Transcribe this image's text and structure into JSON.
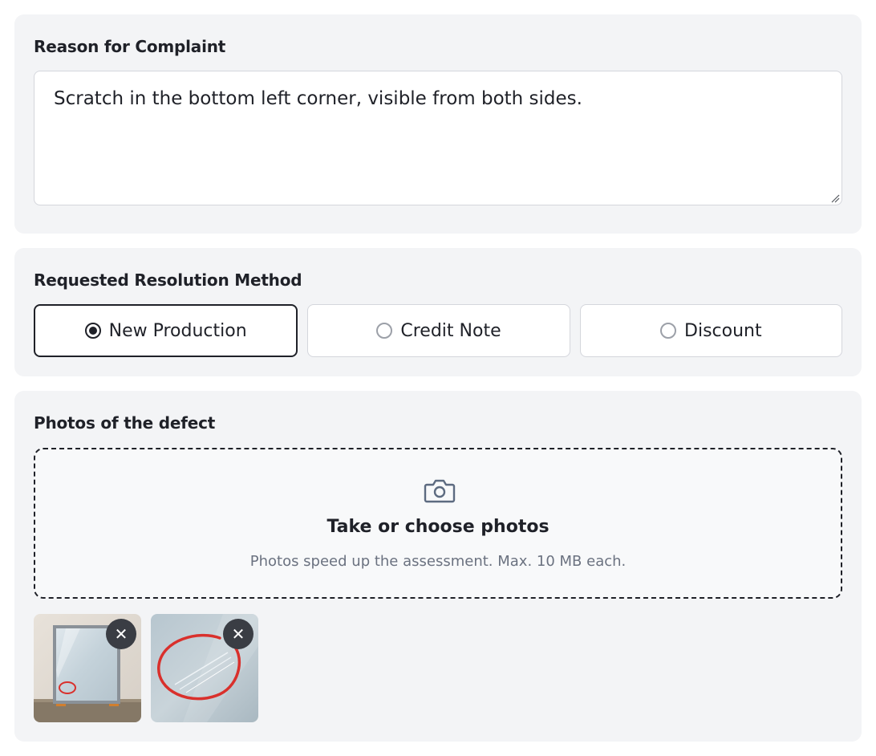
{
  "reason": {
    "title": "Reason for Complaint",
    "text": "Scratch in the bottom left corner, visible from both sides."
  },
  "resolution": {
    "title": "Requested Resolution Method",
    "options": [
      {
        "label": "New Production",
        "selected": true
      },
      {
        "label": "Credit Note",
        "selected": false
      },
      {
        "label": "Discount",
        "selected": false
      }
    ]
  },
  "photos": {
    "title": "Photos of the defect",
    "icon": "camera-icon",
    "cta": "Take or choose photos",
    "hint": "Photos speed up the assessment. Max. 10 MB each.",
    "remove_symbol": "✕",
    "thumbnails": [
      "mirror-photo",
      "scratch-closeup-photo"
    ]
  },
  "colors": {
    "card_bg": "#f3f4f6",
    "text": "#1f2128",
    "muted": "#6b7280",
    "border": "#d4d6dc",
    "annotation_red": "#d9302c"
  }
}
